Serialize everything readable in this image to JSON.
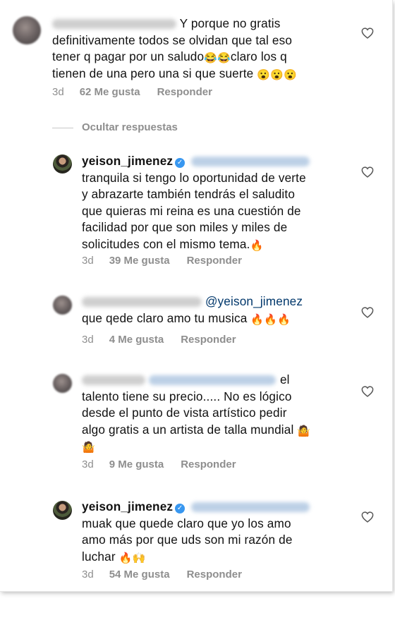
{
  "comments": [
    {
      "username": "",
      "text_lines": [
        "Y porque no gratis",
        "definitivamente todos se olvidan que tal eso",
        "tener q pagar por un saludo",
        "tienen de una pero una si que suerte"
      ],
      "line3_tail": "claro los q",
      "time": "3d",
      "likes": "62 Me gusta",
      "reply": "Responder"
    },
    {
      "username": "yeison_jimenez",
      "text_lines": [
        "tranquila si tengo lo oportunidad de verte",
        "y abrazarte también tendrás el saludito",
        "que quieras mi reina es una cuestión de",
        "facilidad por que son miles y miles de",
        "solicitudes con el mismo tema."
      ],
      "time": "3d",
      "likes": "39 Me gusta",
      "reply": "Responder"
    },
    {
      "username": "",
      "mention": "@yeison_jimenez",
      "text_lines": [
        "que qede claro amo tu musica"
      ],
      "time": "3d",
      "likes": "4 Me gusta",
      "reply": "Responder"
    },
    {
      "username": "",
      "first_word": "el",
      "text_lines": [
        "talento tiene su precio..... No es lógico",
        "desde el punto de vista artístico pedir",
        "algo gratis a un artista de talla mundial"
      ],
      "time": "3d",
      "likes": "9 Me gusta",
      "reply": "Responder"
    },
    {
      "username": "yeison_jimenez",
      "text_lines": [
        "muak que quede claro que yo los amo",
        "amo más por que uds son mi razón de",
        "luchar"
      ],
      "time": "3d",
      "likes": "54 Me gusta",
      "reply": "Responder"
    }
  ],
  "hide_replies": "Ocultar respuestas",
  "icons": {
    "like": "heart-icon",
    "verified": "verified-badge-icon"
  },
  "colors": {
    "meta": "#8e8e8e",
    "verified": "#3897f0",
    "mention": "#00376b"
  }
}
